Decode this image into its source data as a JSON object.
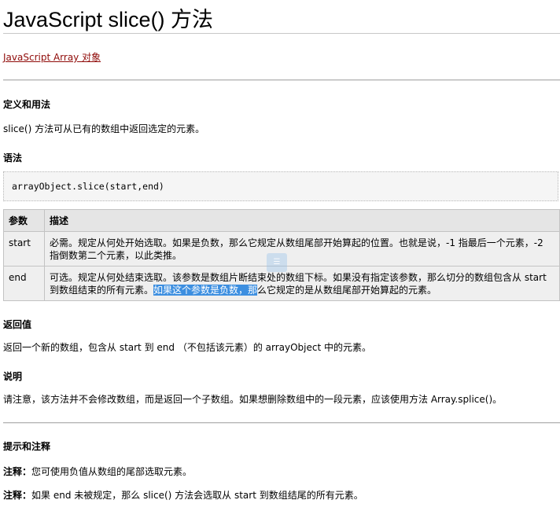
{
  "page": {
    "title": "JavaScript slice() 方法",
    "back_link": "JavaScript Array 对象"
  },
  "definition": {
    "heading": "定义和用法",
    "text": "slice() 方法可从已有的数组中返回选定的元素。"
  },
  "syntax": {
    "heading": "语法",
    "code": "arrayObject.slice(start,end)"
  },
  "params_table": {
    "headers": [
      "参数",
      "描述"
    ],
    "rows": [
      {
        "name": "start",
        "desc_line1": "必需。规定从何处开始选取。如果是负数，那么它规定从数组尾部开始算起的位置。也就是说，-1 指最后一个元素，-2",
        "desc_line2": "指倒数第二个元素，以此类推。"
      },
      {
        "name": "end",
        "desc_line1": "可选。规定从何处结束选取。该参数是数组片断结束处的数组下标。如果没有指定该参数，那么切分的数组包含从 start",
        "desc_line2_before": "到数组结束的所有元素。",
        "desc_line2_selected": "如果这个参数是负数，那",
        "desc_line2_after": "么它规定的是从数组尾部开始算起的元素。"
      }
    ]
  },
  "return_value": {
    "heading": "返回值",
    "text": "返回一个新的数组，包含从 start 到 end （不包括该元素）的 arrayObject 中的元素。"
  },
  "description": {
    "heading": "说明",
    "text": "请注意，该方法并不会修改数组，而是返回一个子数组。如果想删除数组中的一段元素，应该使用方法 Array.splice()。"
  },
  "tips": {
    "heading": "提示和注释",
    "notes": [
      {
        "label": "注释：",
        "text": "您可使用负值从数组的尾部选取元素。"
      },
      {
        "label": "注释：",
        "text": "如果 end 未被规定，那么 slice() 方法会选取从 start 到数组结尾的所有元素。"
      }
    ]
  },
  "colors": {
    "link": "#900b09",
    "selection": "#3d8fe0",
    "table_header_bg": "#e5e5e5",
    "code_bg": "#f5f5f5"
  }
}
